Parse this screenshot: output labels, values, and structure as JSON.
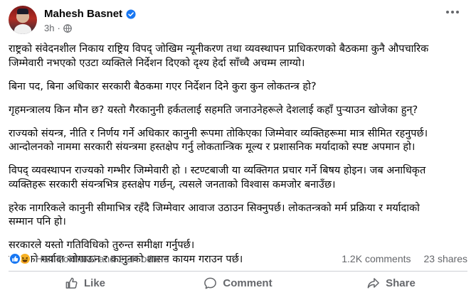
{
  "post": {
    "author": "Mahesh Basnet",
    "time": "3h",
    "separator": "·",
    "paragraphs": [
      [
        "राष्ट्रको संवेदनशील निकाय राष्ट्रिय विपद् जोखिम न्यूनीकरण तथा व्यवस्थापन प्राधिकरणको बैठकमा कुनै औपचारिक",
        "जिम्मेवारी नभएको एउटा व्यक्तिले निर्देशन दिएको दृश्य हेर्दा साँच्चै अचम्म लाग्यो।"
      ],
      [
        "बिना पद, बिना अधिकार सरकारी बैठकमा गएर निर्देशन दिने कुरा   कुन लोकतन्त्र हो?"
      ],
      [
        "गृहमन्त्रालय किन मौन छ? यस्तो गैरकानुनी हर्कतलाई सहमति जनाउनेहरूले देशलाई कहाँ पुर्‍याउन खोजेका हुन्?"
      ],
      [
        "राज्यको संयन्त्र, नीति र निर्णय गर्ने अधिकार कानुनी रूपमा तोकिएका जिम्मेवार व्यक्तिहरूमा मात्र सीमित रहनुपर्छ।",
        "आन्दोलनको नाममा सरकारी संयन्त्रमा हस्तक्षेप गर्नु लोकतान्त्रिक मूल्य र प्रशासनिक मर्यादाको स्पष्ट अपमान हो।"
      ],
      [
        "विपद् व्यवस्थापन राज्यको गम्भीर जिम्मेवारी हो । स्टण्टबाजी या व्यक्तिगत प्रचार गर्ने बिषय होइन। जब  अनाधिकृत",
        "व्यक्तिहरू सरकारी संयन्त्रभित्र हस्तक्षेप गर्छन्, त्यसले जनताको विश्वास कमजोर बनाउँछ।"
      ],
      [
        "हरेक नागरिकले कानुनी सीमाभित्र रहँदै जिम्मेवार आवाज उठाउन सिक्नुपर्छ। लोकतन्त्रको मर्म प्रक्रिया र मर्यादाको",
        "सम्मान पनि हो।"
      ],
      [
        "सरकारले यस्तो गतिविधिको तुरुन्त समीक्षा गर्नुपर्छ।",
        "राज्यको मर्यादा जोगाऊन र कानुनको शासन कायम गराउन पर्छ।"
      ]
    ]
  },
  "stats": {
    "reactions_text": "Hari Pokharel and 2.3K others",
    "comments": "1.2K comments",
    "shares": "23 shares"
  },
  "actions": {
    "like": "Like",
    "comment": "Comment",
    "share": "Share"
  },
  "colors": {
    "accent": "#1877f2",
    "muted": "#65676b",
    "haha": "#f7b125"
  },
  "icons": [
    "verified-badge-icon",
    "globe-icon",
    "more-options-icon",
    "like-reaction-icon",
    "haha-reaction-icon",
    "thumbs-up-icon",
    "comment-icon",
    "share-icon"
  ]
}
